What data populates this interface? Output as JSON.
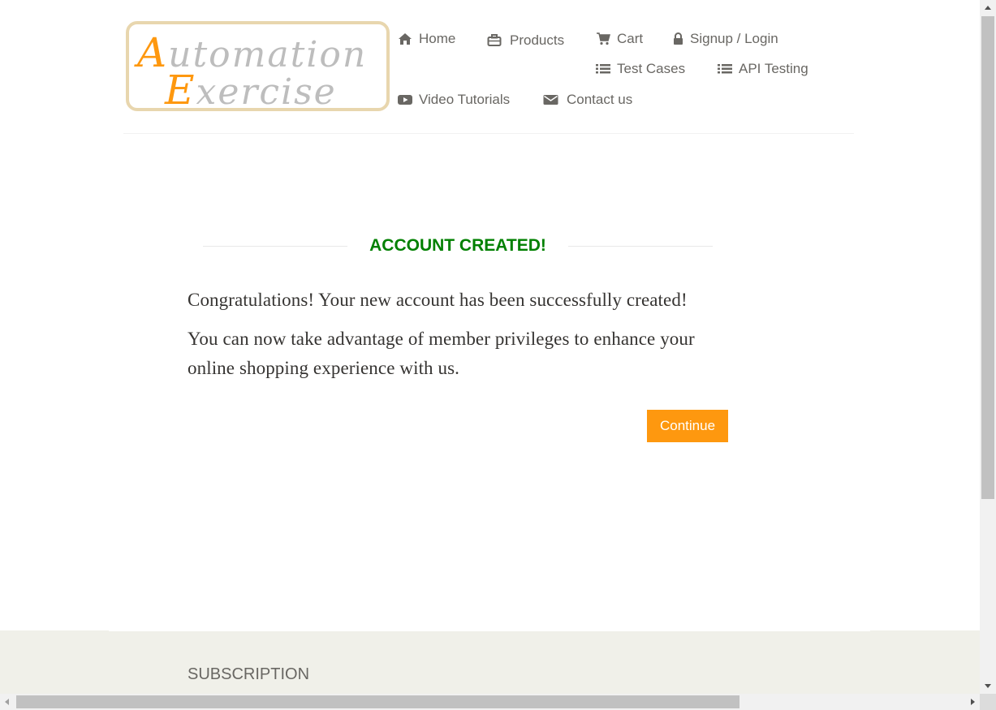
{
  "logo": {
    "line1_cap": "A",
    "line1_rest": "utomation",
    "line2_cap": "E",
    "line2_rest": "xercise"
  },
  "nav": [
    {
      "label": "Home",
      "icon": "home-icon"
    },
    {
      "label": "Products",
      "icon": "briefcase-icon"
    },
    {
      "label": "Cart",
      "icon": "cart-icon"
    },
    {
      "label": "Signup / Login",
      "icon": "lock-icon"
    },
    {
      "label": "Test Cases",
      "icon": "list-icon"
    },
    {
      "label": "API Testing",
      "icon": "list-icon"
    },
    {
      "label": "Video Tutorials",
      "icon": "youtube-play-icon"
    },
    {
      "label": "Contact us",
      "icon": "envelope-icon"
    }
  ],
  "main": {
    "title": "ACCOUNT CREATED!",
    "paragraph1": "Congratulations! Your new account has been successfully created!",
    "paragraph2": "You can now take advantage of member privileges to enhance your online shopping experience with us.",
    "continue_label": "Continue"
  },
  "footer": {
    "subscription_title": "SUBSCRIPTION"
  },
  "colors": {
    "accent": "#fe980f",
    "success": "#008000",
    "text": "#696763",
    "footer_bg": "#f0f0e9"
  }
}
